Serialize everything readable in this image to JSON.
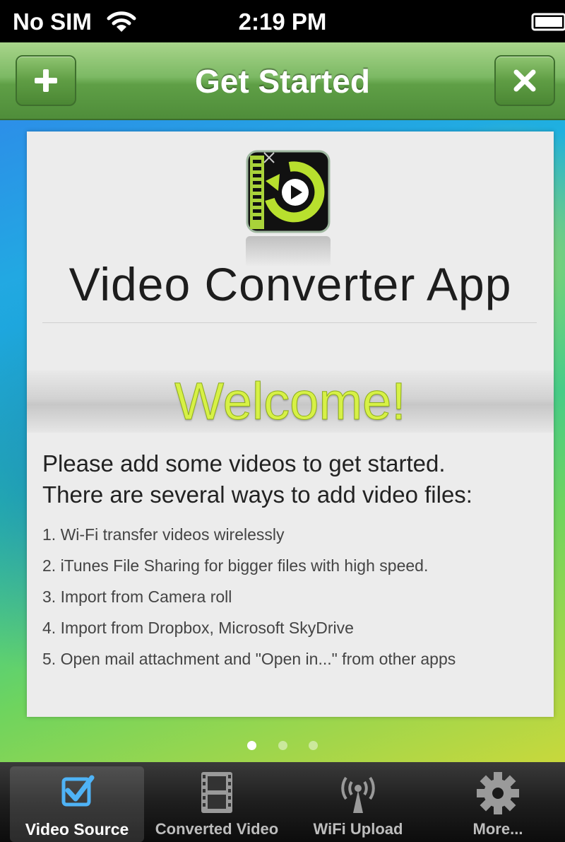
{
  "status_bar": {
    "carrier": "No SIM",
    "time": "2:19 PM",
    "wifi_icon": "wifi-icon",
    "battery_icon": "battery-icon"
  },
  "nav_bar": {
    "title": "Get Started",
    "add_button_icon": "plus-icon",
    "close_button_icon": "close-icon"
  },
  "card": {
    "app_icon": "video-converter-app-icon",
    "app_name": "Video Converter App",
    "welcome": "Welcome!",
    "intro_line_1": "Please add some videos to get started.",
    "intro_line_2": "There are several ways to add video files:",
    "ways": [
      "1. Wi-Fi transfer videos wirelessly",
      "2. iTunes File Sharing for bigger files with high speed.",
      "3. Import from Camera roll",
      "4. Import from Dropbox, Microsoft SkyDrive",
      "5. Open mail attachment and \"Open in...\" from other apps"
    ]
  },
  "pager": {
    "page_count": 3,
    "current_page": 1
  },
  "tab_bar": {
    "tabs": [
      {
        "label": "Video Source",
        "icon": "checkbox-icon",
        "selected": true
      },
      {
        "label": "Converted Video",
        "icon": "film-icon",
        "selected": false
      },
      {
        "label": "WiFi Upload",
        "icon": "antenna-icon",
        "selected": false
      },
      {
        "label": "More...",
        "icon": "gear-icon",
        "selected": false
      }
    ]
  },
  "colors": {
    "nav_green": "#6aaa4f",
    "welcome_yellow_green": "#d7f146",
    "selected_tab_icon": "#4fb3f6"
  }
}
